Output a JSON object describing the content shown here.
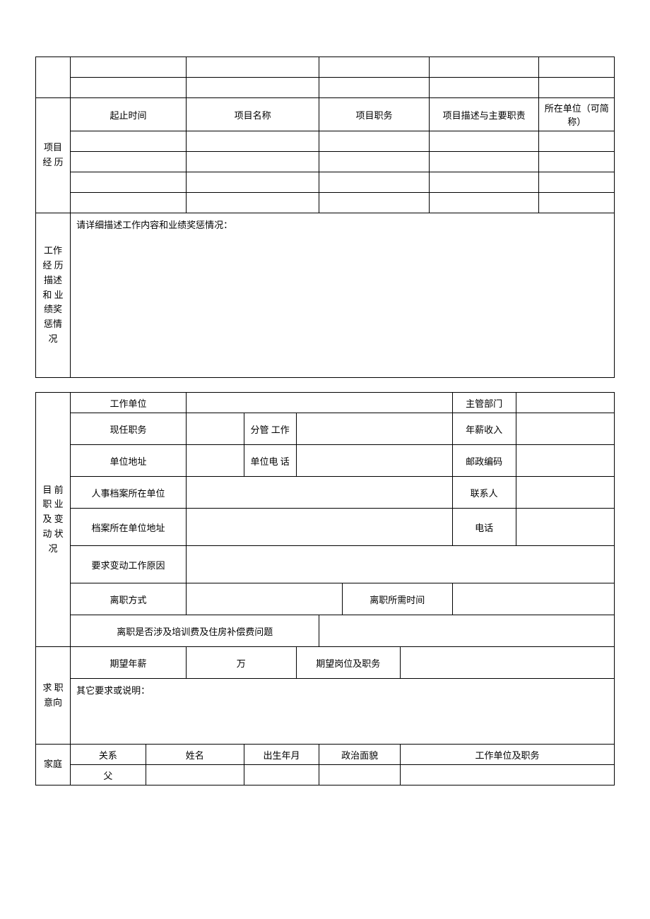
{
  "project": {
    "section": "项目 经 历",
    "headers": {
      "time": "起止时间",
      "name": "项目名称",
      "role": "项目职务",
      "desc": "项目描述与主要职责",
      "unit": "所在单位（可简称）"
    }
  },
  "workdesc": {
    "section": "工作经 历描述 和 业绩奖 惩情况",
    "prompt": "请详细描述工作内容和业绩奖惩情况："
  },
  "current": {
    "section": "目 前 职 业 及 变 动 状 况",
    "workUnit": "工作单位",
    "deptHead": "主管部门",
    "position": "现任职务",
    "inCharge": "分管 工作",
    "salary": "年薪收入",
    "address": "单位地址",
    "phone": "单位电 话",
    "postcode": "邮政编码",
    "hrFileUnit": "人事档案所在单位",
    "contact": "联系人",
    "fileAddress": "档案所在单位地址",
    "tel": "电话",
    "changeReason": "要求变动工作原因",
    "leaveMethod": "离职方式",
    "leaveTime": "离职所需时间",
    "leaveFee": "离职是否涉及培训费及住房补偿费问题"
  },
  "intention": {
    "section": "求 职 意向",
    "expectSalary": "期望年薪",
    "wan": "万",
    "expectPosition": "期望岗位及职务",
    "other": "其它要求或说明："
  },
  "family": {
    "section": "家庭",
    "relation": "关系",
    "name": "姓名",
    "birth": "出生年月",
    "politics": "政治面貌",
    "workPosition": "工作单位及职务",
    "father": "父"
  }
}
